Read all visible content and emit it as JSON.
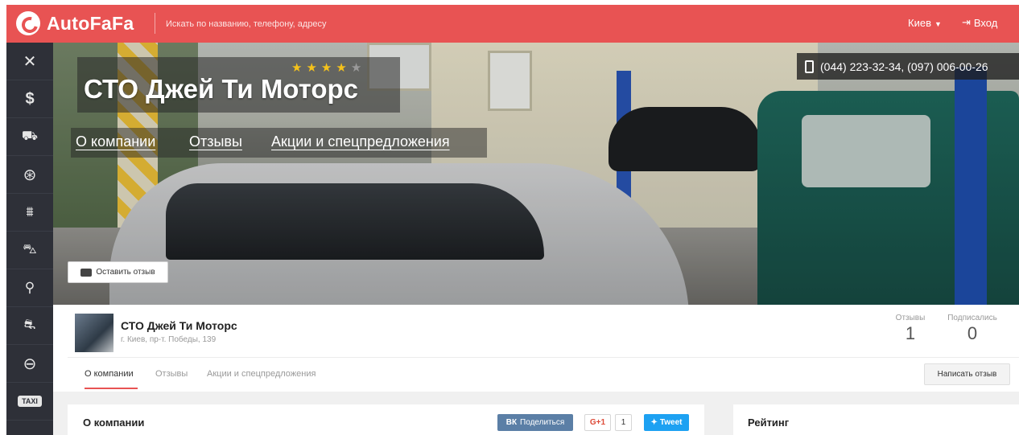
{
  "header": {
    "logo_text": "AutoFaFa",
    "search_placeholder": "Искать по названию, телефону, адресу",
    "city": "Киев",
    "login": "Вход",
    "brand_color": "#e85353"
  },
  "sidebar": {
    "items": [
      {
        "icon": "wrench-screwdriver-icon"
      },
      {
        "icon": "dollar-icon"
      },
      {
        "icon": "tow-truck-icon"
      },
      {
        "icon": "wheel-icon"
      },
      {
        "icon": "car-lift-icon"
      },
      {
        "icon": "car-wash-icon"
      },
      {
        "icon": "spark-plug-icon"
      },
      {
        "icon": "car-side-icon"
      },
      {
        "icon": "steering-wheel-icon"
      },
      {
        "icon": "taxi-icon"
      }
    ]
  },
  "hero": {
    "title": "СТО Джей Ти Моторс",
    "rating_stars": 4,
    "rating_max": 5,
    "tabs": [
      "О компании",
      "Отзывы",
      "Акции и спецпредложения"
    ],
    "phones": "(044) 223-32-34, (097) 006-00-26",
    "review_button": "Оставить отзыв"
  },
  "info": {
    "name": "СТО Джей Ти Моторс",
    "address": "г. Киев, пр-т. Победы, 139",
    "stats": [
      {
        "label": "Отзывы",
        "value": "1"
      },
      {
        "label": "Подписались",
        "value": "0"
      }
    ],
    "tabs": [
      "О компании",
      "Отзывы",
      "Акции и спецпредложения"
    ],
    "active_tab": 0,
    "write_review_button": "Написать отзыв"
  },
  "about_card": {
    "title": "О компании",
    "vk_label": "Поделиться",
    "vk_icon": "ВК",
    "gplus_label": "G+1",
    "gplus_count": "1",
    "tweet_label": "Tweet"
  },
  "rating_card": {
    "title": "Рейтинг"
  }
}
